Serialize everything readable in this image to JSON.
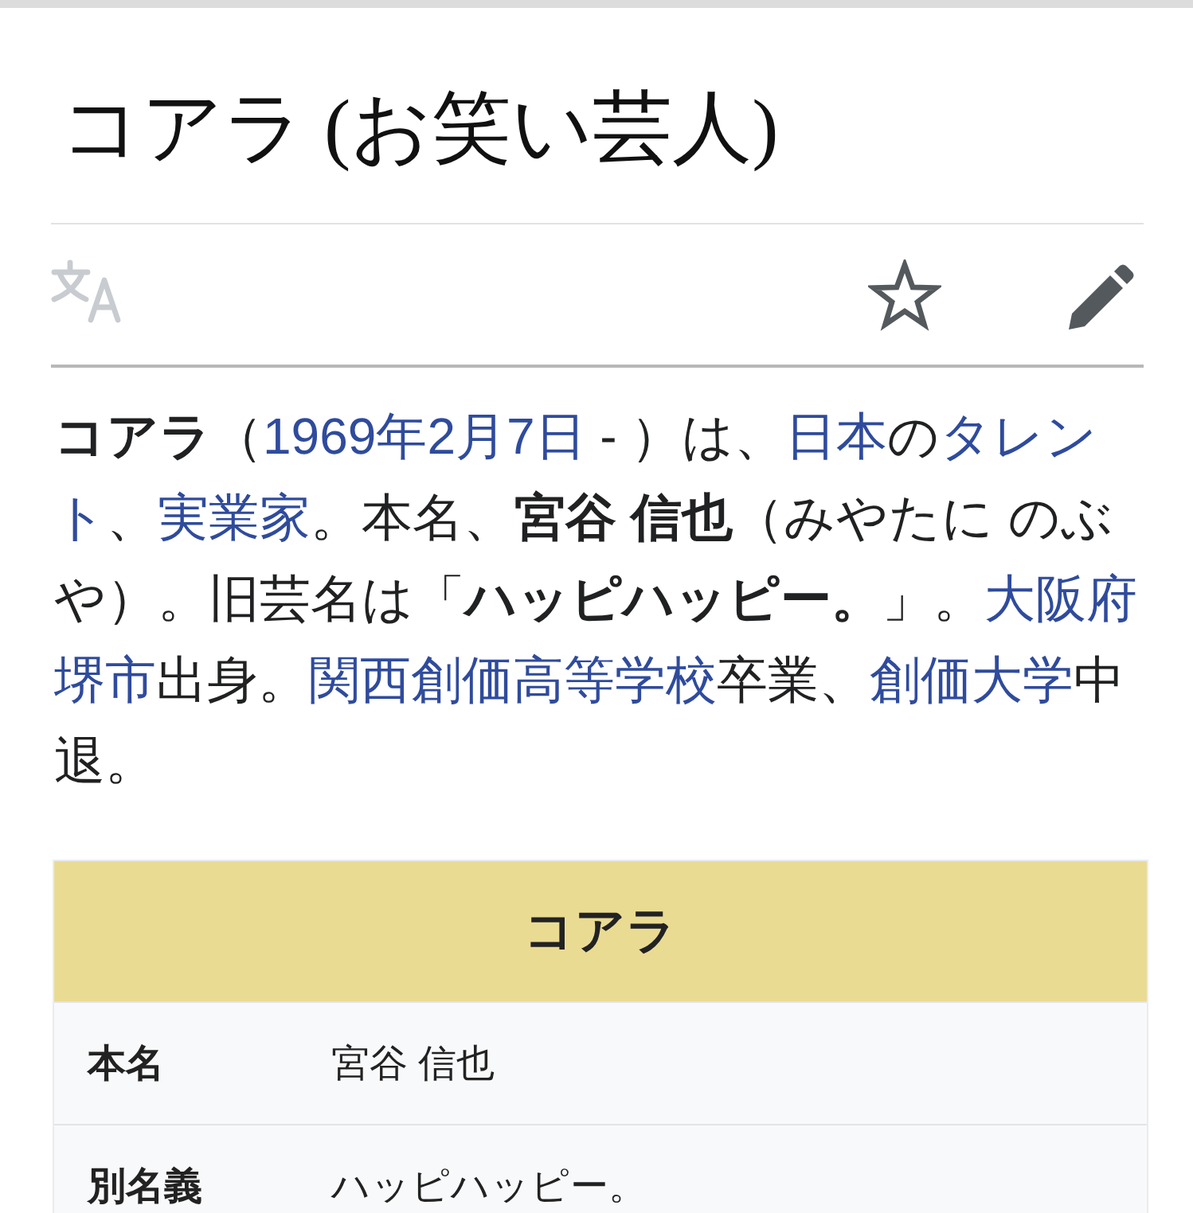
{
  "title": "コアラ (お笑い芸人)",
  "toolbar": {
    "language": {
      "disabled": true
    },
    "watch": {
      "watched": false
    },
    "edit": {
      "disabled": false
    }
  },
  "intro": [
    {
      "kind": "bold",
      "text": "コアラ"
    },
    {
      "kind": "text",
      "text": "（"
    },
    {
      "kind": "link",
      "text": "1969年2月7日"
    },
    {
      "kind": "text",
      "text": " - ）は、"
    },
    {
      "kind": "link",
      "text": "日本"
    },
    {
      "kind": "text",
      "text": "の"
    },
    {
      "kind": "link",
      "text": "タレン"
    },
    {
      "kind": "link",
      "text": "ト"
    },
    {
      "kind": "text",
      "text": "、"
    },
    {
      "kind": "link",
      "text": "実業家"
    },
    {
      "kind": "text",
      "text": "。本名、"
    },
    {
      "kind": "bold",
      "text": "宮谷 信也"
    },
    {
      "kind": "text",
      "text": "（みやたに のぶや）。旧芸名は「"
    },
    {
      "kind": "bold",
      "text": "ハッピハッピー。"
    },
    {
      "kind": "text",
      "text": "」。"
    },
    {
      "kind": "link",
      "text": "大阪府"
    },
    {
      "kind": "link",
      "text": "堺市"
    },
    {
      "kind": "text",
      "text": "出身。"
    },
    {
      "kind": "link",
      "text": "関西創価高等学校"
    },
    {
      "kind": "text",
      "text": "卒業、"
    },
    {
      "kind": "link",
      "text": "創価大学"
    },
    {
      "kind": "text",
      "text": "中退。"
    }
  ],
  "infobox": {
    "title": "コアラ",
    "rows": [
      {
        "label": "本名",
        "value": "宮谷 信也"
      },
      {
        "label": "別名義",
        "value": "ハッピハッピー。"
      }
    ]
  }
}
